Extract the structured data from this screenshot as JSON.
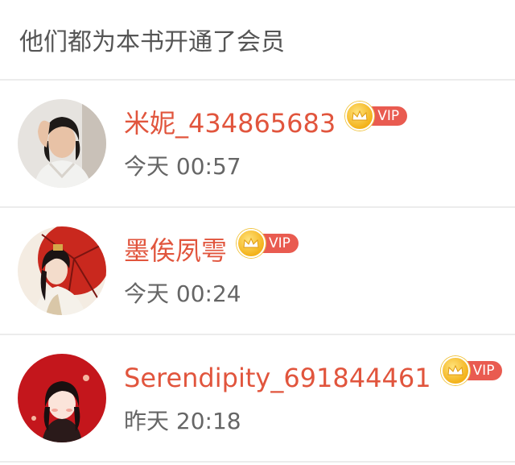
{
  "header": {
    "title": "他们都为本书开通了会员"
  },
  "members": [
    {
      "name": "米妮_434865683",
      "vip_label": "VIP",
      "time": "今天 00:57"
    },
    {
      "name": "墨俟夙雩",
      "vip_label": "VIP",
      "time": "今天 00:24"
    },
    {
      "name": "Serendipity_691844461",
      "vip_label": "VIP",
      "time": "昨天 20:18"
    }
  ],
  "colors": {
    "name": "#e1553d",
    "vip_tag": "#e95b50",
    "crown": "#f3b21a",
    "divider": "#ececec"
  },
  "icons": {
    "badge": "crown-icon"
  }
}
